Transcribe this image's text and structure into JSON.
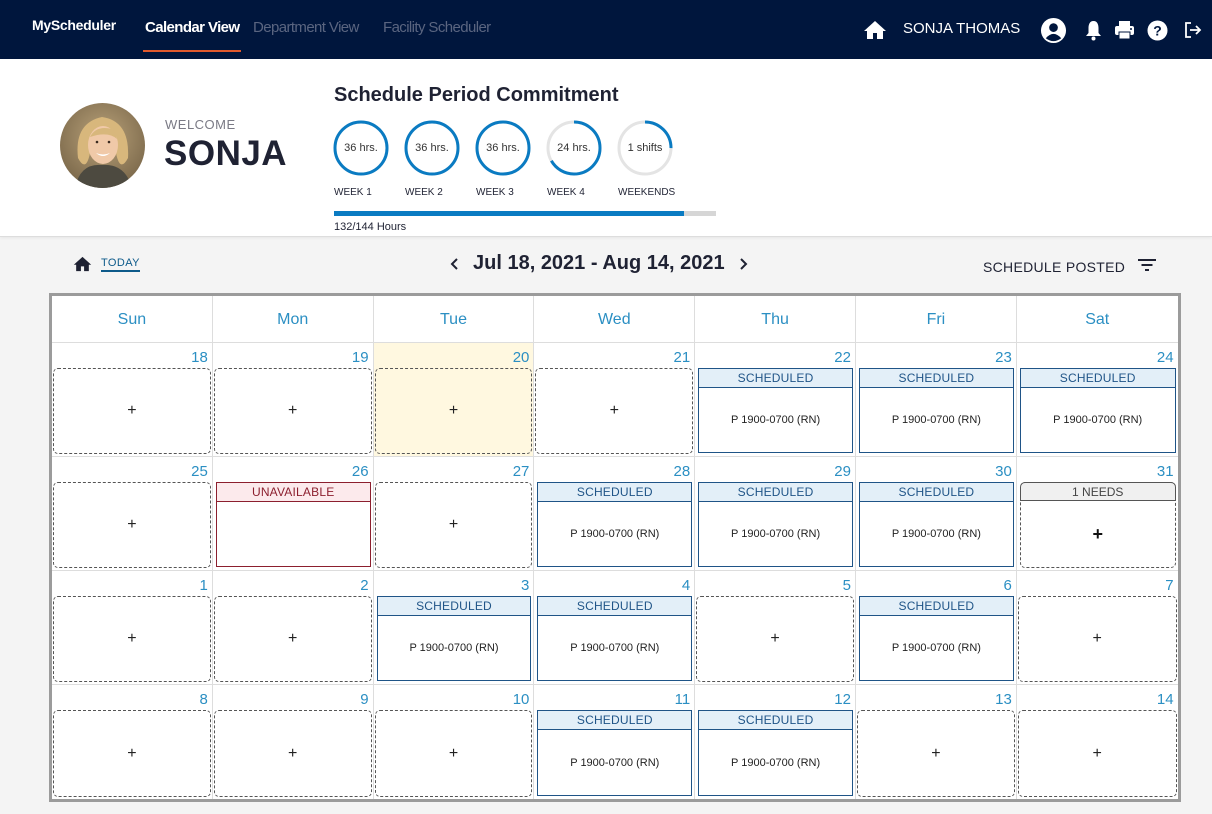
{
  "nav": {
    "brand": "MyScheduler",
    "tabs": [
      {
        "label": "Calendar View",
        "active": true
      },
      {
        "label": "Department View",
        "active": false
      },
      {
        "label": "Facility Scheduler",
        "active": false
      }
    ],
    "user_name": "SONJA THOMAS",
    "icons": [
      "home-icon",
      "user-circle-icon",
      "bell-icon",
      "print-icon",
      "help-icon",
      "logout-icon"
    ]
  },
  "welcome": {
    "label": "WELCOME",
    "name": "SONJA"
  },
  "commitment": {
    "title": "Schedule Period Commitment",
    "rings": [
      {
        "label": "WEEK 1",
        "value": "36 hrs.",
        "fraction": 1.0
      },
      {
        "label": "WEEK 2",
        "value": "36 hrs.",
        "fraction": 1.0
      },
      {
        "label": "WEEK 3",
        "value": "36 hrs.",
        "fraction": 1.0
      },
      {
        "label": "WEEK 4",
        "value": "24 hrs.",
        "fraction": 0.667
      },
      {
        "label": "WEEKENDS",
        "value": "1 shifts",
        "fraction": 0.25
      }
    ],
    "progress_fraction": 0.917,
    "progress_label": "132/144 Hours",
    "ring_color": "#0a7bc2",
    "track_color": "#e4e4e4"
  },
  "toolbar": {
    "today_label": "TODAY",
    "date_range": "Jul 18, 2021 - Aug 14, 2021",
    "status_label": "SCHEDULE POSTED"
  },
  "calendar": {
    "days_of_week": [
      "Sun",
      "Mon",
      "Tue",
      "Wed",
      "Thu",
      "Fri",
      "Sat"
    ],
    "weeks": [
      [
        {
          "day": "18",
          "type": "open"
        },
        {
          "day": "19",
          "type": "open"
        },
        {
          "day": "20",
          "type": "open",
          "today": true
        },
        {
          "day": "21",
          "type": "open"
        },
        {
          "day": "22",
          "type": "scheduled",
          "status": "SCHEDULED",
          "shift": "P 1900-0700 (RN)"
        },
        {
          "day": "23",
          "type": "scheduled",
          "status": "SCHEDULED",
          "shift": "P 1900-0700 (RN)"
        },
        {
          "day": "24",
          "type": "scheduled",
          "status": "SCHEDULED",
          "shift": "P 1900-0700 (RN)"
        }
      ],
      [
        {
          "day": "25",
          "type": "open"
        },
        {
          "day": "26",
          "type": "unavailable",
          "status": "UNAVAILABLE"
        },
        {
          "day": "27",
          "type": "open"
        },
        {
          "day": "28",
          "type": "scheduled",
          "status": "SCHEDULED",
          "shift": "P 1900-0700 (RN)"
        },
        {
          "day": "29",
          "type": "scheduled",
          "status": "SCHEDULED",
          "shift": "P 1900-0700 (RN)"
        },
        {
          "day": "30",
          "type": "scheduled",
          "status": "SCHEDULED",
          "shift": "P 1900-0700 (RN)"
        },
        {
          "day": "31",
          "type": "needs",
          "status": "1 NEEDS"
        }
      ],
      [
        {
          "day": "1",
          "type": "open"
        },
        {
          "day": "2",
          "type": "open"
        },
        {
          "day": "3",
          "type": "scheduled",
          "status": "SCHEDULED",
          "shift": "P 1900-0700 (RN)"
        },
        {
          "day": "4",
          "type": "scheduled",
          "status": "SCHEDULED",
          "shift": "P 1900-0700 (RN)"
        },
        {
          "day": "5",
          "type": "open"
        },
        {
          "day": "6",
          "type": "scheduled",
          "status": "SCHEDULED",
          "shift": "P 1900-0700 (RN)"
        },
        {
          "day": "7",
          "type": "open"
        }
      ],
      [
        {
          "day": "8",
          "type": "open"
        },
        {
          "day": "9",
          "type": "open"
        },
        {
          "day": "10",
          "type": "open"
        },
        {
          "day": "11",
          "type": "scheduled",
          "status": "SCHEDULED",
          "shift": "P 1900-0700 (RN)"
        },
        {
          "day": "12",
          "type": "scheduled",
          "status": "SCHEDULED",
          "shift": "P 1900-0700 (RN)"
        },
        {
          "day": "13",
          "type": "open"
        },
        {
          "day": "14",
          "type": "open"
        }
      ]
    ],
    "add_symbol": "+"
  }
}
